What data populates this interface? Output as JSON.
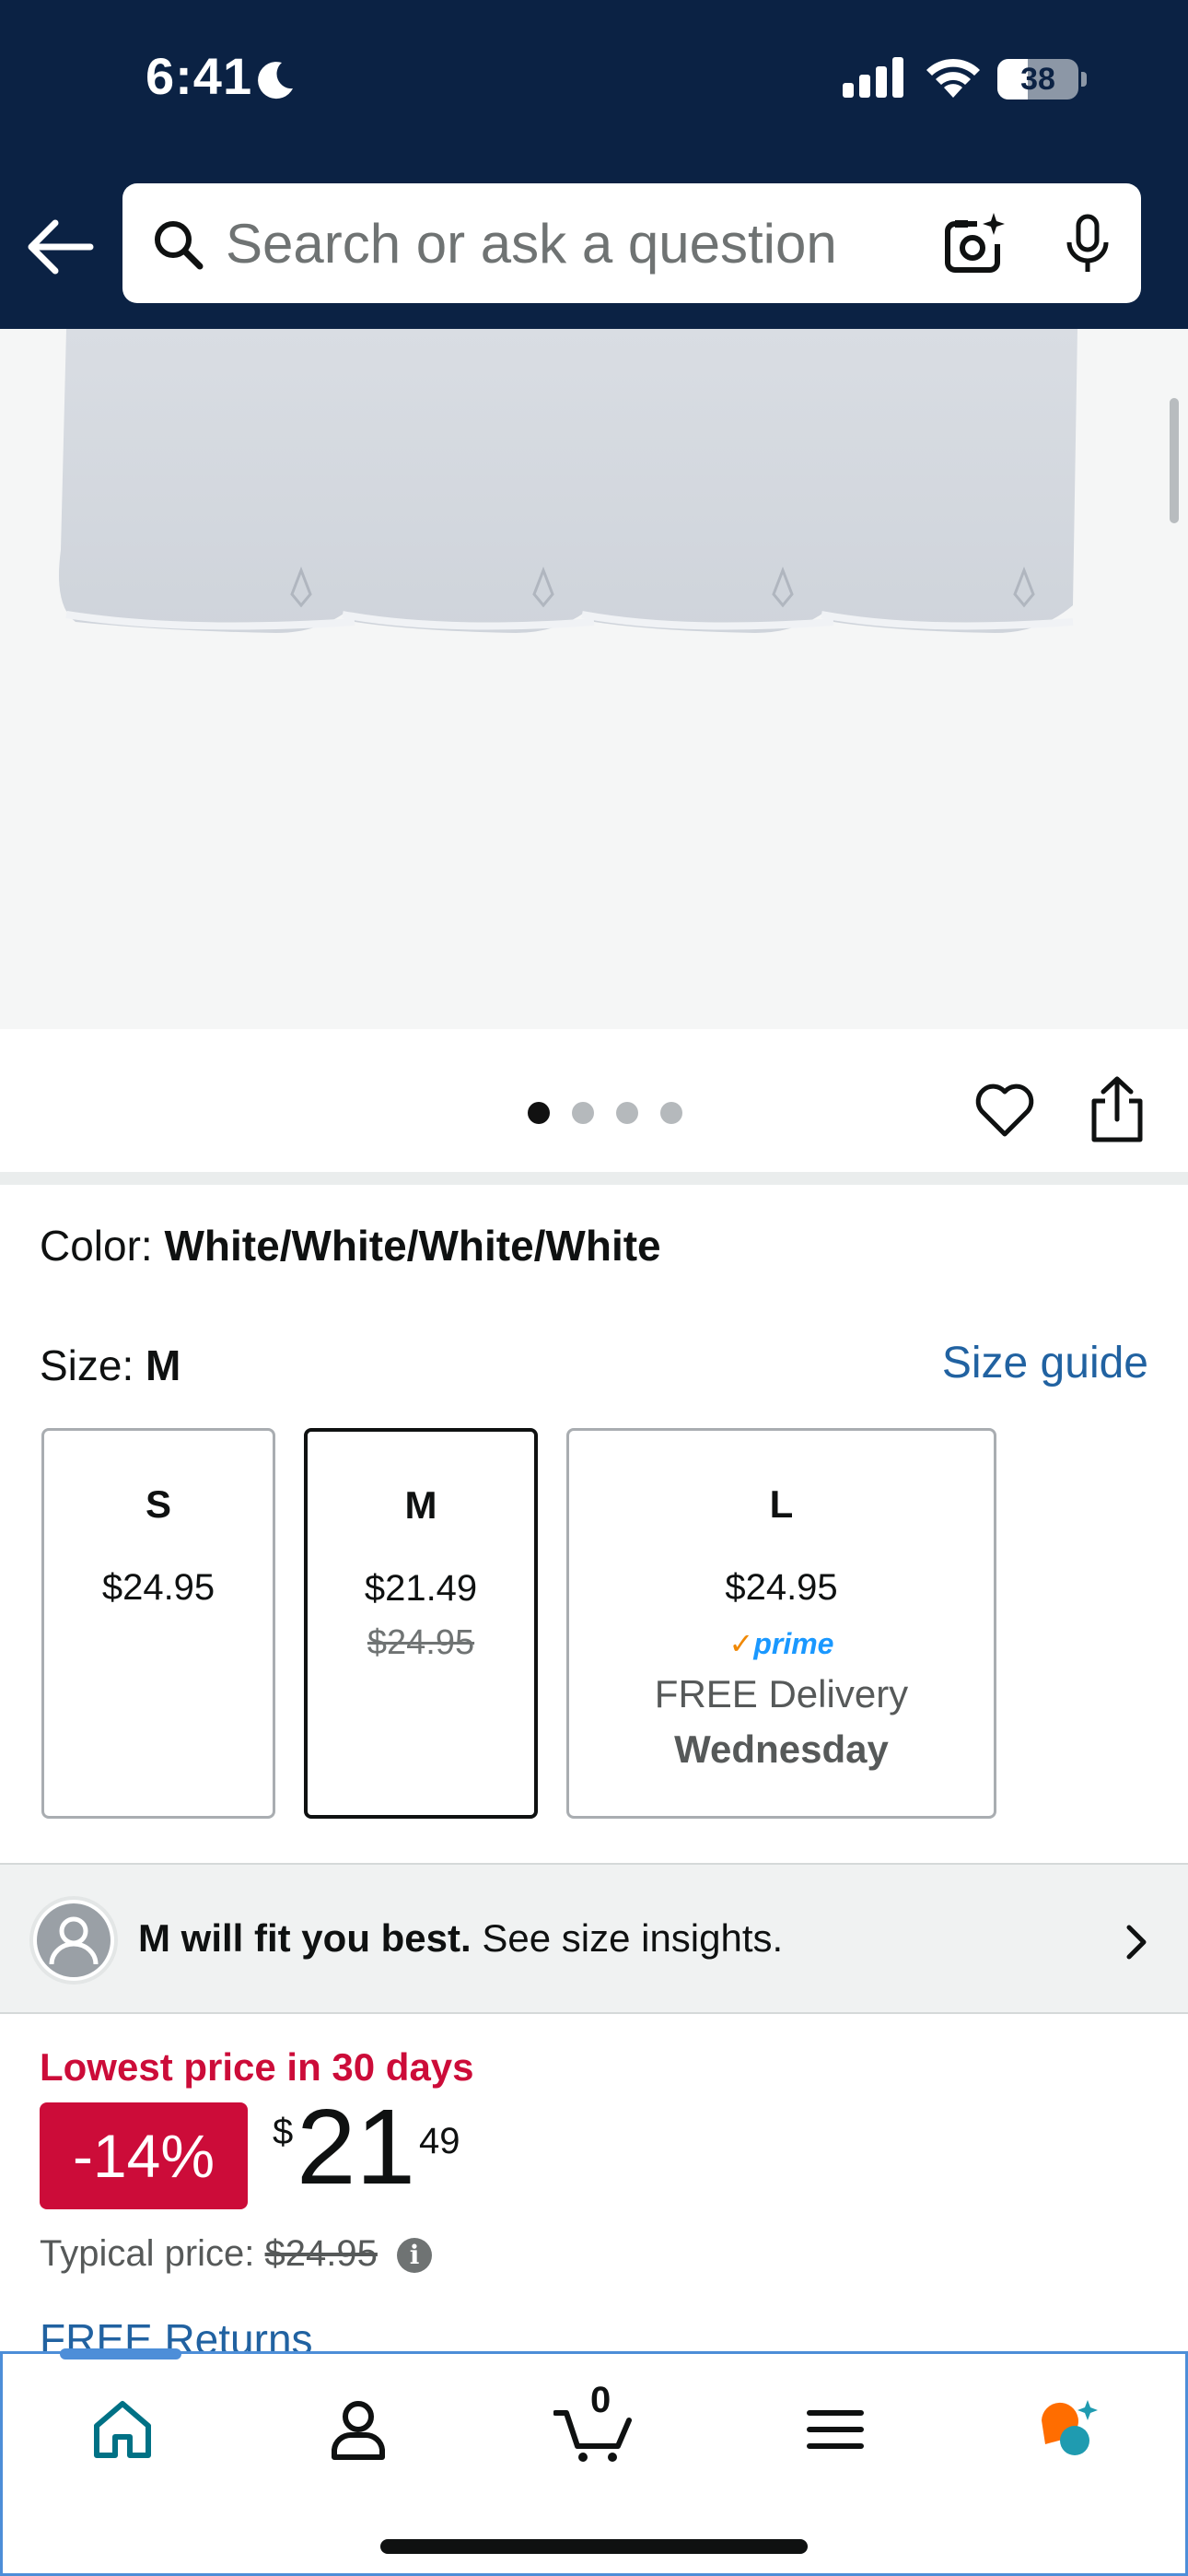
{
  "status_bar": {
    "time": "6:41",
    "battery_level": "38",
    "battery_fraction": 0.38
  },
  "header": {
    "search_placeholder": "Search or ask a question",
    "icons": [
      "back-arrow-icon",
      "search-icon",
      "camera-lens-icon",
      "microphone-icon"
    ]
  },
  "gallery": {
    "image_count": 4,
    "active_index": 0,
    "icons": [
      "heart-icon",
      "share-icon"
    ]
  },
  "variation": {
    "color_label": "Color:",
    "color_value": "White/White/White/White",
    "size_label": "Size:",
    "size_value": "M",
    "size_guide_link": "Size guide",
    "sizes": [
      {
        "label": "S",
        "price": "$24.95"
      },
      {
        "label": "M",
        "price": "$21.49",
        "old_price": "$24.95",
        "selected": true
      },
      {
        "label": "L",
        "price": "$24.95",
        "prime": "prime",
        "delivery": "FREE Delivery",
        "delivery_day": "Wednesday"
      }
    ]
  },
  "fit_insight": {
    "bold_text": "M will fit you best.",
    "text": "See size insights."
  },
  "price": {
    "badge_text": "Lowest price in 30 days",
    "discount": "-14%",
    "currency": "$",
    "whole": "21",
    "fraction": "49",
    "typical_label": "Typical price:",
    "typical_value": "$24.95",
    "free_returns": "FREE Returns"
  },
  "bottom_nav": {
    "items": [
      "home-icon",
      "account-icon",
      "cart-icon",
      "menu-icon",
      "rufus-chat-icon"
    ],
    "cart_count": "0"
  },
  "colors": {
    "header_bg": "#0b2244",
    "link": "#2162a1",
    "deal_red": "#cc0c39",
    "prime_blue": "#1a98ff",
    "home_teal": "#007185",
    "nav_highlight": "#4d8ed8"
  }
}
